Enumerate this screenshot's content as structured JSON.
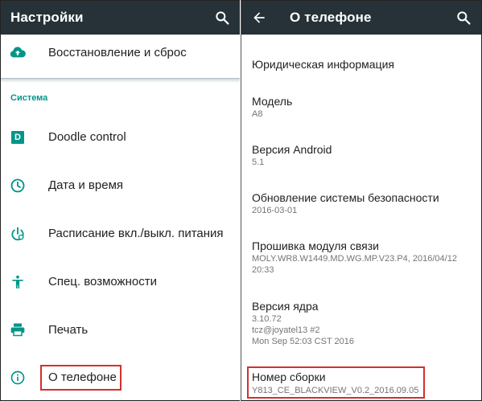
{
  "left": {
    "title": "Настройки",
    "top_item": {
      "label": "Восстановление и сброс",
      "icon": "cloud-upload-icon"
    },
    "section": "Система",
    "items": [
      {
        "label": "Doodle control",
        "icon": "doodle-icon",
        "icon_letter": "D"
      },
      {
        "label": "Дата и время",
        "icon": "clock-icon"
      },
      {
        "label": "Расписание вкл./выкл. питания",
        "icon": "power-schedule-icon"
      },
      {
        "label": "Спец. возможности",
        "icon": "accessibility-icon"
      },
      {
        "label": "Печать",
        "icon": "print-icon"
      },
      {
        "label": "О телефоне",
        "icon": "info-icon"
      }
    ]
  },
  "right": {
    "title": "О телефоне",
    "items": [
      {
        "title": "Юридическая информация"
      },
      {
        "title": "Модель",
        "value": "A8"
      },
      {
        "title": "Версия Android",
        "value": "5.1"
      },
      {
        "title": "Обновление системы безопасности",
        "value": "2016-03-01"
      },
      {
        "title": "Прошивка модуля связи",
        "value_lines": [
          "MOLY.WR8.W1449.MD.WG.MP.V23.P4, 2016/04/12",
          "20:33"
        ]
      },
      {
        "title": "Версия ядра",
        "value_lines": [
          "3.10.72",
          "tcz@joyatel13 #2",
          "Mon Sep 52:03 CST 2016"
        ]
      },
      {
        "title": "Номер сборки",
        "value": "Y813_CE_BLACKVIEW_V0.2_2016.09.05"
      }
    ]
  },
  "colors": {
    "appbar": "#263238",
    "accent": "#009688",
    "highlight": "#d32f2f"
  }
}
